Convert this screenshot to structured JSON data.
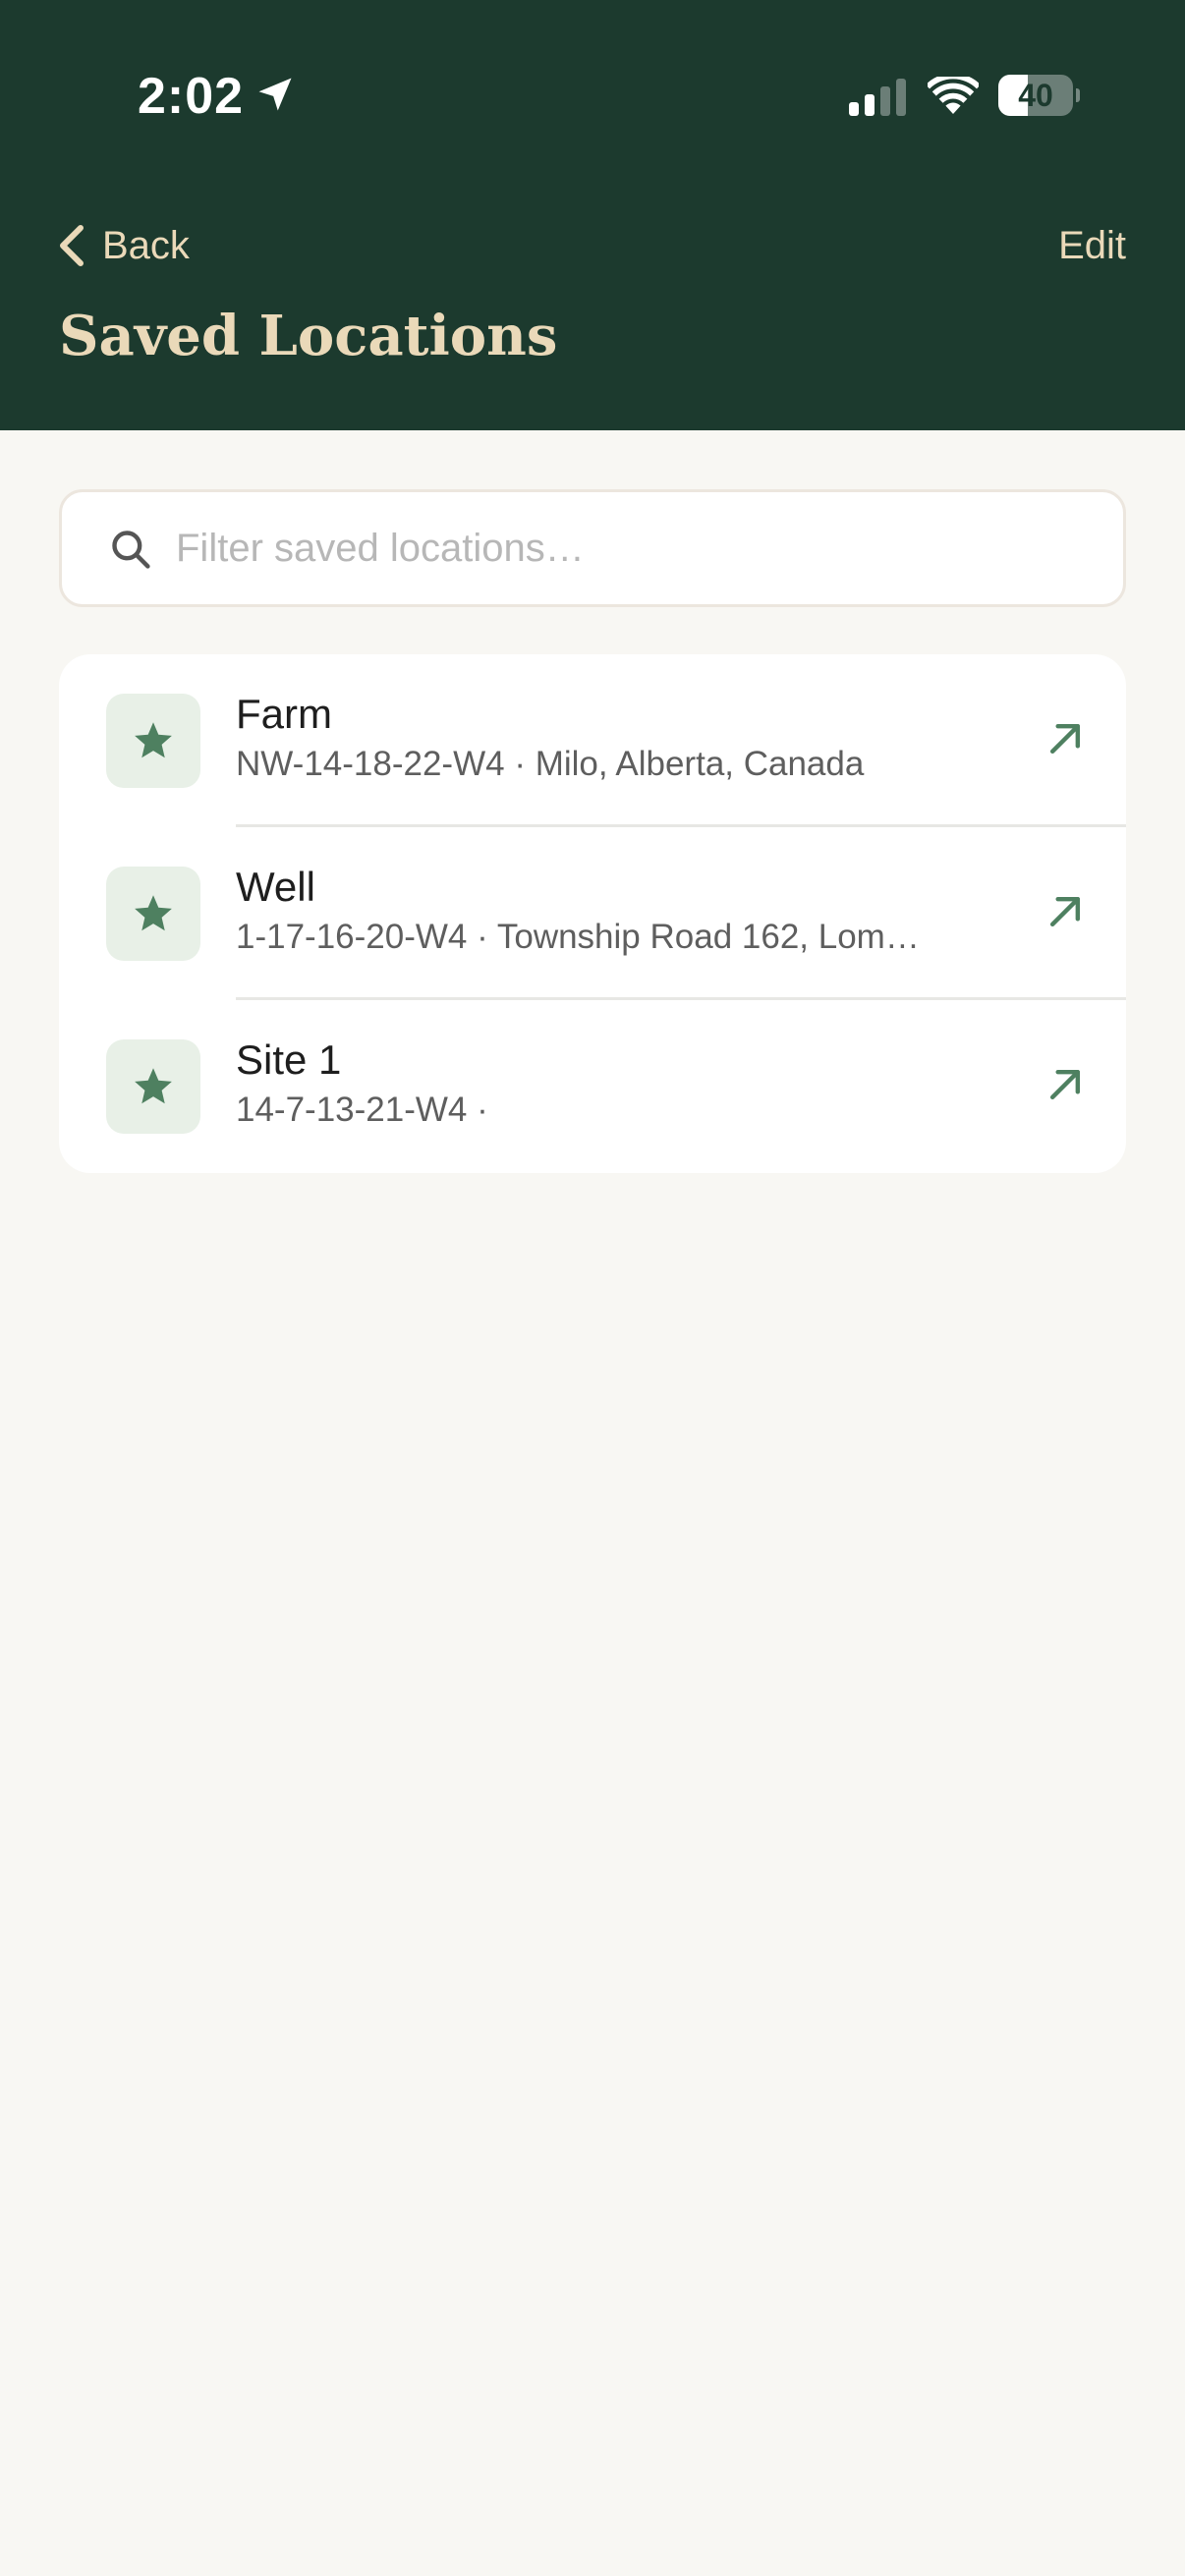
{
  "status_bar": {
    "time": "2:02",
    "battery": "40",
    "battery_level": 0.4,
    "signal_bars_active": 2,
    "signal_bars_total": 4
  },
  "nav": {
    "back_label": "Back",
    "edit_label": "Edit",
    "title": "Saved Locations"
  },
  "search": {
    "placeholder": "Filter saved locations…"
  },
  "locations": [
    {
      "name": "Farm",
      "detail": "NW-14-18-22-W4 · Milo, Alberta, Canada"
    },
    {
      "name": "Well",
      "detail": "1-17-16-20-W4 · Township Road 162, Lom…"
    },
    {
      "name": "Site 1",
      "detail": "14-7-13-21-W4 ·"
    }
  ],
  "colors": {
    "header_bg": "#1c3a2e",
    "accent_text": "#ead9b9",
    "icon_green": "#4e8060",
    "badge_bg": "#e8f0e7",
    "page_bg": "#f8f7f3"
  }
}
